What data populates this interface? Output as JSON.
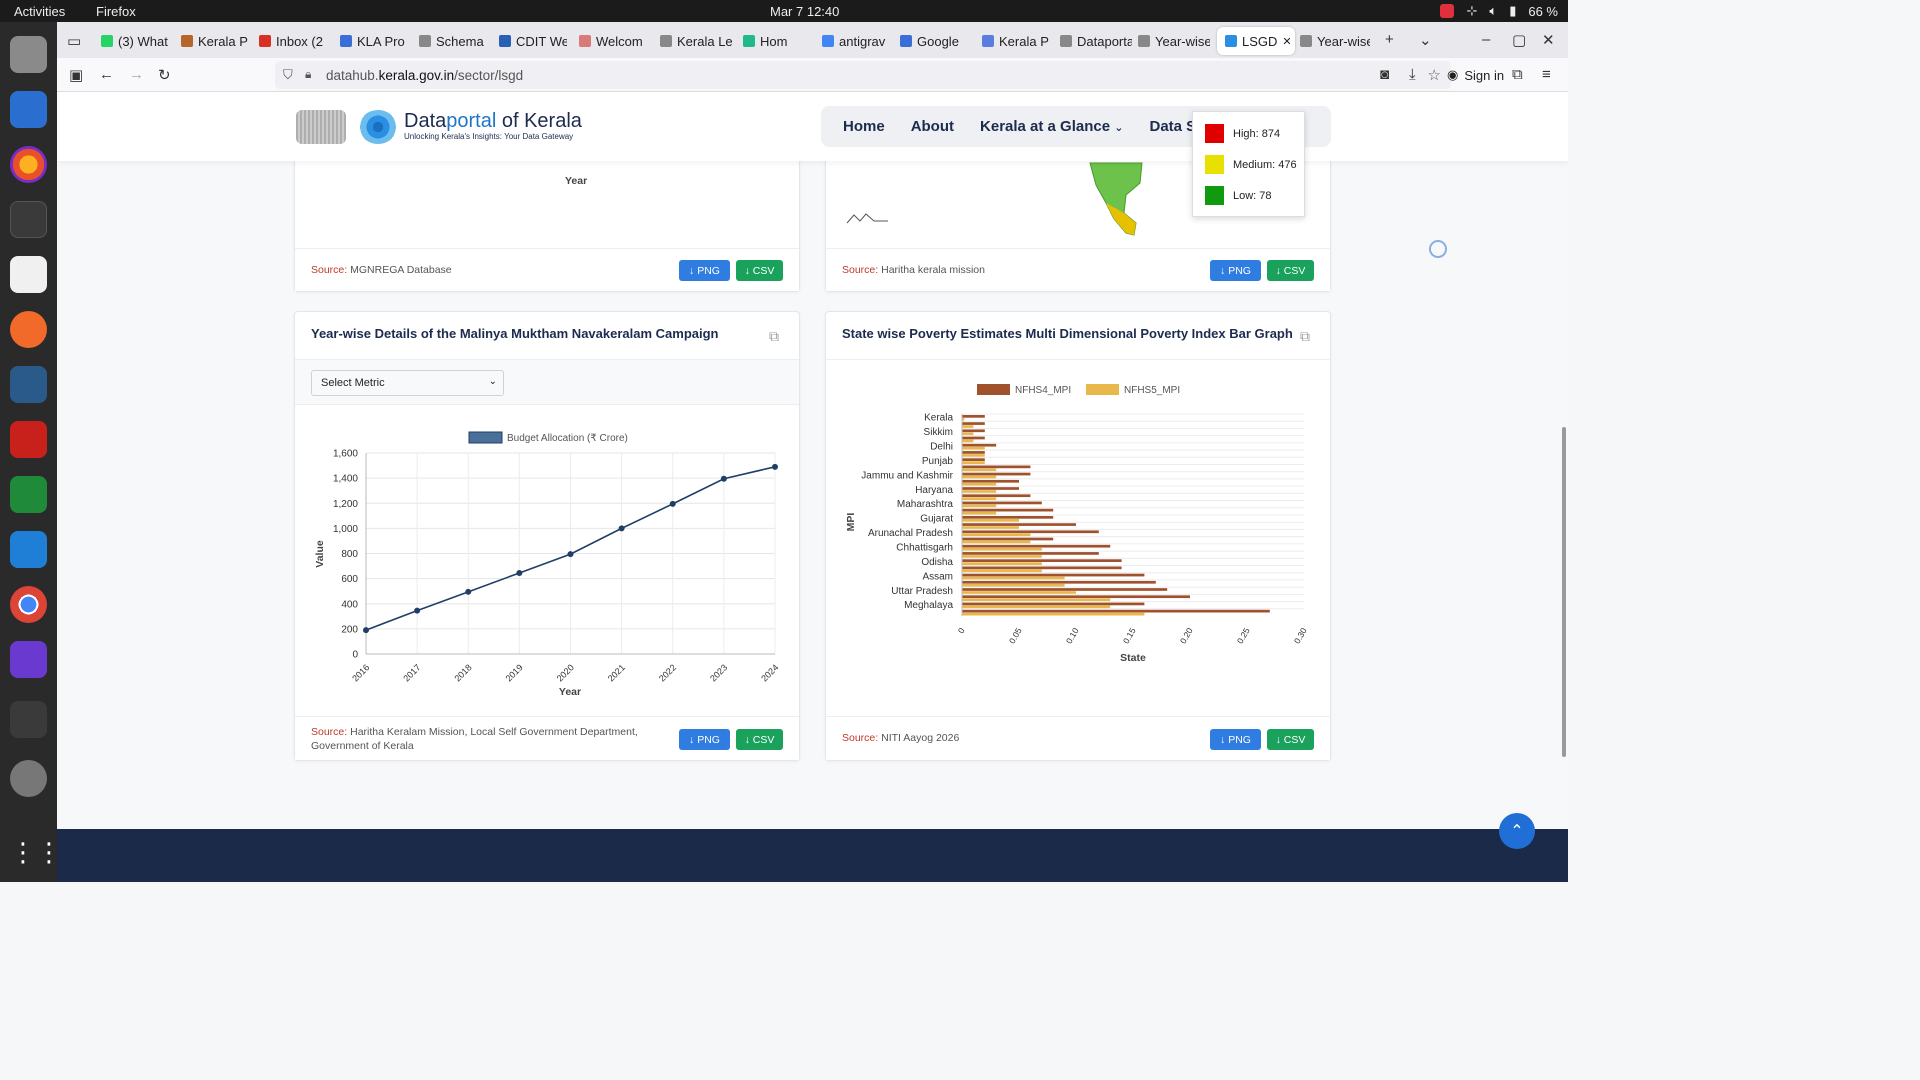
{
  "system": {
    "activities": "Activities",
    "app_name": "Firefox",
    "clock": "Mar 7  12:40",
    "battery": "66 %"
  },
  "browser": {
    "tabs": [
      {
        "label": "(3) What",
        "color": "#25d366"
      },
      {
        "label": "Kerala P",
        "color": "#b8652a"
      },
      {
        "label": "Inbox (2",
        "color": "#d93025"
      },
      {
        "label": "KLA Pro",
        "color": "#3b6fd8"
      },
      {
        "label": "Schema of",
        "color": "#888888"
      },
      {
        "label": "CDIT We",
        "color": "#2a5fb8"
      },
      {
        "label": "Welcom",
        "color": "#d97a7a"
      },
      {
        "label": "Kerala Legi",
        "color": "#888888"
      },
      {
        "label": "Hom",
        "color": "#1fb98a"
      },
      {
        "label": "antigrav",
        "color": "#4285f4"
      },
      {
        "label": "Google",
        "color": "#3b6fd8"
      },
      {
        "label": "Kerala P",
        "color": "#5a7de0"
      },
      {
        "label": "Dataportal",
        "color": "#888888"
      },
      {
        "label": "Year-wise D",
        "color": "#888888"
      },
      {
        "label": "LSGD",
        "color": "#2a8fe0",
        "active": true
      },
      {
        "label": "Year-wise D",
        "color": "#888888"
      }
    ],
    "url_host": "datahub.",
    "url_domain": "kerala.gov.in",
    "url_path": "/sector/lsgd",
    "signin_label": "Sign in"
  },
  "site": {
    "logo_title_a": "Data",
    "logo_title_b": "portal",
    "logo_title_c": " of Kerala",
    "logo_subtitle": "Unlocking Kerala's Insights: Your Data Gateway",
    "nav": [
      "Home",
      "About",
      "Kerala at a Glance",
      "Data Set"
    ]
  },
  "map_legend": {
    "items": [
      {
        "label": "High: 874",
        "color": "#e00000"
      },
      {
        "label": "Medium: 476",
        "color": "#e8e000"
      },
      {
        "label": "Low: 78",
        "color": "#109a10"
      }
    ]
  },
  "top_left_card": {
    "xlabel": "Year",
    "source_label": "Source:",
    "source": "MGNREGA Database",
    "png": "↓ PNG",
    "csv": "↓ CSV"
  },
  "top_right_card": {
    "source_label": "Source:",
    "source": "Haritha kerala mission",
    "png": "↓ PNG",
    "csv": "↓ CSV"
  },
  "malinya_card": {
    "title": "Year-wise Details of the Malinya Muktham Navakeralam Campaign",
    "select_label": "Select Metric",
    "source_label": "Source:",
    "source_line1": "Haritha Keralam Mission, Local Self Government Department,",
    "source_line2": "Government of Kerala",
    "png": "↓ PNG",
    "csv": "↓ CSV"
  },
  "poverty_card": {
    "title": "State wise Poverty Estimates Multi Dimensional Poverty Index Bar Graph",
    "source_label": "Source:",
    "source": "NITI Aayog 2026",
    "png": "↓ PNG",
    "csv": "↓ CSV"
  },
  "chart_data": [
    {
      "type": "line",
      "title": "",
      "series": [
        {
          "name": "Budget Allocation (₹ Crore)",
          "color": "#1f3f66",
          "values": [
            190,
            345,
            495,
            645,
            795,
            1000,
            1195,
            1395,
            1490
          ]
        }
      ],
      "x": [
        "2016",
        "2017",
        "2018",
        "2019",
        "2020",
        "2021",
        "2022",
        "2023",
        "2024"
      ],
      "xlabel": "Year",
      "ylabel": "Value",
      "ylim": [
        0,
        1600
      ],
      "yticks": [
        "0",
        "200",
        "400",
        "600",
        "800",
        "1,000",
        "1,200",
        "1,400",
        "1,600"
      ],
      "grid": true,
      "legend": "top-center"
    },
    {
      "type": "bar",
      "orientation": "horizontal",
      "categories": [
        "Kerala",
        "",
        "Sikkim",
        "",
        "Delhi",
        "",
        "Punjab",
        "",
        "Jammu and Kashmir",
        "",
        "Haryana",
        "",
        "Maharashtra",
        "",
        "Gujarat",
        "",
        "Arunachal Pradesh",
        "",
        "Chhattisgarh",
        "",
        "Odisha",
        "",
        "Assam",
        "",
        "Uttar Pradesh",
        "",
        "Meghalaya",
        ""
      ],
      "series": [
        {
          "name": "NFHS4_MPI",
          "color": "#a0522d",
          "values": [
            0.02,
            0.02,
            0.02,
            0.02,
            0.03,
            0.02,
            0.02,
            0.06,
            0.06,
            0.05,
            0.05,
            0.06,
            0.07,
            0.08,
            0.08,
            0.1,
            0.12,
            0.08,
            0.13,
            0.12,
            0.14,
            0.14,
            0.16,
            0.17,
            0.18,
            0.2,
            0.16,
            0.27
          ]
        },
        {
          "name": "NFHS5_MPI",
          "color": "#e8b84a",
          "values": [
            0.002,
            0.01,
            0.01,
            0.01,
            0.02,
            0.02,
            0.02,
            0.03,
            0.03,
            0.03,
            0.03,
            0.03,
            0.03,
            0.03,
            0.05,
            0.05,
            0.06,
            0.06,
            0.07,
            0.07,
            0.07,
            0.07,
            0.09,
            0.09,
            0.1,
            0.13,
            0.13,
            0.16
          ]
        }
      ],
      "xlim": [
        0,
        0.3
      ],
      "xticks": [
        "0",
        "0.05",
        "0.10",
        "0.15",
        "0.20",
        "0.25",
        "0.30"
      ],
      "xlabel": "State",
      "ylabel": "MPI",
      "legend": "top-center"
    }
  ]
}
